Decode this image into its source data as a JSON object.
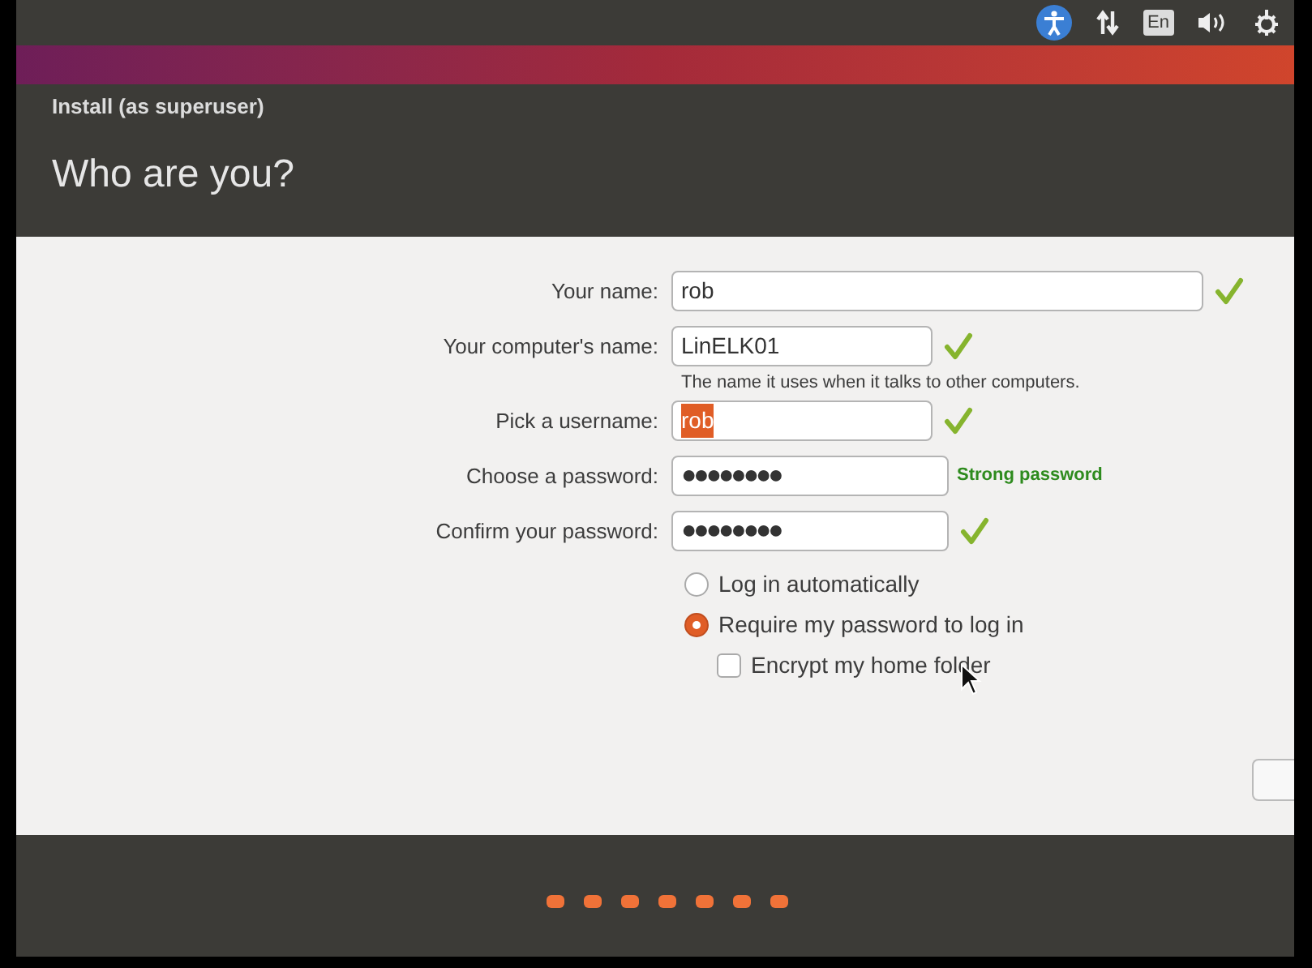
{
  "top_panel": {
    "keyboard_layout": "En"
  },
  "window": {
    "title": "Install (as superuser)",
    "heading": "Who are you?"
  },
  "fields": [
    {
      "label": "Your name:",
      "value": "rob",
      "highlighted": false,
      "status": {
        "kind": "check"
      }
    },
    {
      "label": "Your computer's name:",
      "value": "LinELK01",
      "highlighted": false,
      "status": {
        "kind": "check"
      },
      "hint": "The name it uses when it talks to other computers."
    },
    {
      "label": "Pick a username:",
      "value": "rob",
      "highlighted": true,
      "status": {
        "kind": "check"
      }
    },
    {
      "label": "Choose a password:",
      "value": "●●●●●●●●",
      "highlighted": false,
      "status": {
        "kind": "text",
        "text": "Strong password"
      }
    },
    {
      "label": "Confirm your password:",
      "value": "●●●●●●●●",
      "highlighted": false,
      "status": {
        "kind": "check"
      }
    }
  ],
  "login_options": [
    {
      "kind": "radio",
      "label": "Log in automatically",
      "selected": false
    },
    {
      "kind": "radio",
      "label": "Require my password to log in",
      "selected": true
    },
    {
      "kind": "checkbox",
      "label": "Encrypt my home folder",
      "checked": false
    }
  ]
}
